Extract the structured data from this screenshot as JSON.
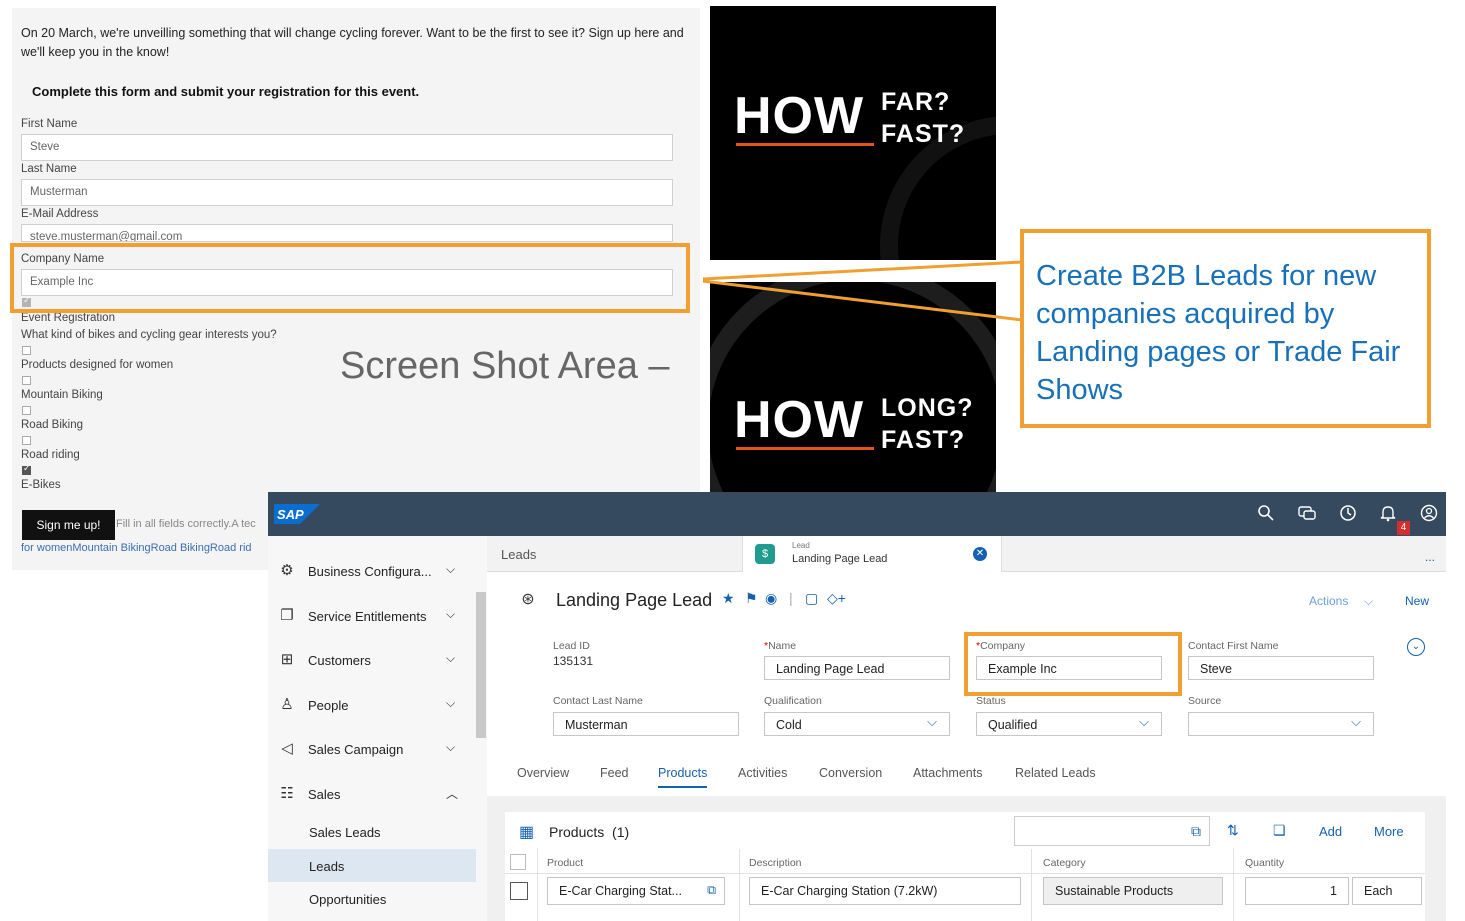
{
  "landing_form": {
    "intro": "On 20 March, we're unveilling something that will change cycling forever. Want to be the first to see it? Sign up here and we'll keep you in the know!",
    "heading": "Complete this form and submit your registration for this event.",
    "first_name_label": "First Name",
    "first_name_value": "Steve",
    "last_name_label": "Last Name",
    "last_name_value": "Musterman",
    "email_label": "E-Mail Address",
    "email_value": "steve.musterman@gmail.com",
    "company_label": "Company Name",
    "company_value": "Example Inc",
    "event_registration_label": "Event Registration",
    "interests_question": "What kind of bikes and cycling gear interests you?",
    "options": [
      {
        "label": "Products designed for women",
        "checked": false
      },
      {
        "label": "Mountain Biking",
        "checked": false
      },
      {
        "label": "Road Biking",
        "checked": false
      },
      {
        "label": "Road riding",
        "checked": false
      },
      {
        "label": "E-Bikes",
        "checked": true
      }
    ],
    "submit_label": "Sign me up!",
    "validation_hint": "Fill in all fields correctly.A tec",
    "interests_summary": "for womenMountain BikingRoad BikingRoad rid"
  },
  "promo_top": {
    "how": "HOW",
    "line1": "FAR?",
    "line2": "FAST?"
  },
  "promo_bottom": {
    "how": "HOW",
    "line1": "LONG?",
    "line2": "FAST?"
  },
  "caption": "Screen Shot Area –",
  "callout": "Create B2B Leads for new companies acquired by Landing pages or Trade Fair Shows",
  "sap": {
    "logo": "SAP",
    "notification_count": "4",
    "header_icons": [
      "search-icon",
      "chat-icon",
      "clock-icon",
      "bell-icon",
      "user-icon"
    ],
    "nav": [
      {
        "label": "Business Configura...",
        "icon": "config-icon"
      },
      {
        "label": "Service Entitlements",
        "icon": "entitlement-icon"
      },
      {
        "label": "Customers",
        "icon": "customers-icon"
      },
      {
        "label": "People",
        "icon": "person-icon"
      },
      {
        "label": "Sales Campaign",
        "icon": "megaphone-icon"
      },
      {
        "label": "Sales",
        "icon": "sales-icon"
      }
    ],
    "sub_nav": [
      "Sales Leads",
      "Leads",
      "Opportunities"
    ],
    "tabs": {
      "leads": "Leads",
      "lead_small": "Lead",
      "lead_title": "Landing Page Lead",
      "more": "..."
    },
    "object": {
      "title": "Landing Page Lead",
      "actions": "Actions",
      "new": "New",
      "fields": {
        "lead_id_label": "Lead ID",
        "lead_id_value": "135131",
        "name_label": "Name",
        "name_value": "Landing Page Lead",
        "company_label": "Company",
        "company_value": "Example Inc",
        "contact_first_label": "Contact First Name",
        "contact_first_value": "Steve",
        "contact_last_label": "Contact Last Name",
        "contact_last_value": "Musterman",
        "qualification_label": "Qualification",
        "qualification_value": "Cold",
        "status_label": "Status",
        "status_value": "Qualified",
        "source_label": "Source",
        "source_value": ""
      }
    },
    "detail_tabs": [
      "Overview",
      "Feed",
      "Products",
      "Activities",
      "Conversion",
      "Attachments",
      "Related Leads"
    ],
    "products": {
      "title": "Products",
      "count": "(1)",
      "add": "Add",
      "more": "More",
      "columns": [
        "Product",
        "Description",
        "Category",
        "Quantity"
      ],
      "row": {
        "product": "E-Car Charging Stat...",
        "description": "E-Car Charging Station (7.2kW)",
        "category": "Sustainable Products",
        "quantity": "1",
        "unit": "Each"
      }
    }
  },
  "colors": {
    "highlight": "#f0a030",
    "callout_text": "#1871b8",
    "sap_header": "#354a5f",
    "sap_link": "#1560b0",
    "promo_accent": "#e0551f"
  }
}
